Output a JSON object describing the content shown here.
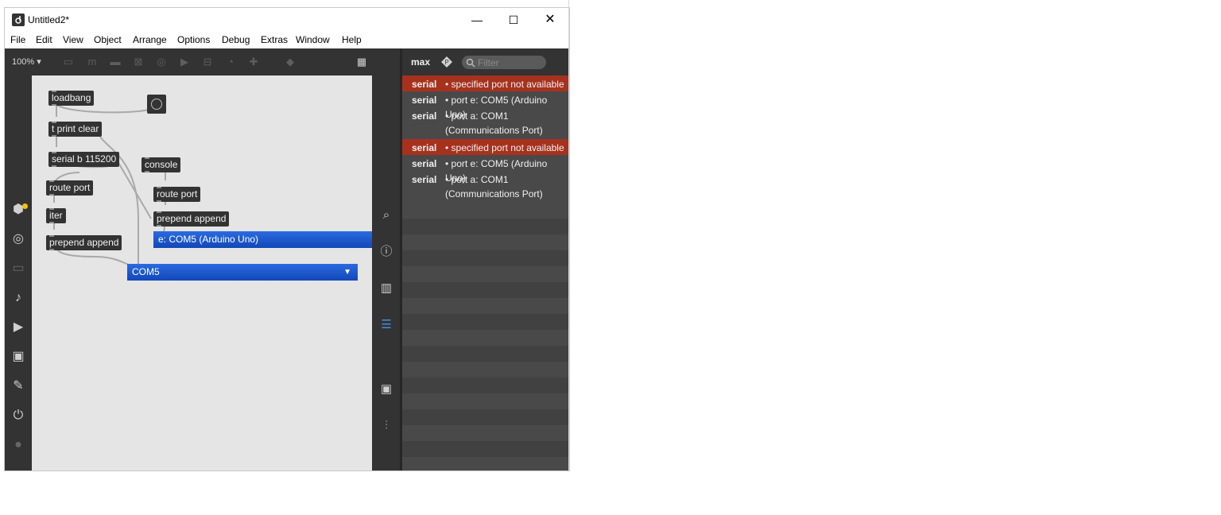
{
  "window": {
    "title": "Untitled2*"
  },
  "menu": [
    "File",
    "Edit",
    "View",
    "Object",
    "Arrange",
    "Options",
    "Debug",
    "Extras",
    "Window",
    "Help"
  ],
  "toolbar": {
    "zoom": "100%"
  },
  "patch": {
    "objects": {
      "loadbang": "loadbang",
      "trigger": "t print clear",
      "serial": "serial b 115200",
      "console": "console",
      "route_left": "route port",
      "route_right": "route port",
      "iter": "iter",
      "prepend_left": "prepend append",
      "prepend_right": "prepend append"
    },
    "menus": {
      "port_menu": "e: COM5 (Arduino Uno)",
      "com_menu": "COM5"
    }
  },
  "console": {
    "title": "max",
    "filter_placeholder": "Filter",
    "messages": [
      {
        "source": "serial",
        "text": "• specified port not available",
        "error": true
      },
      {
        "source": "serial",
        "text": "• port e: COM5 (Arduino Uno)",
        "error": false
      },
      {
        "source": "serial",
        "text": "• port a: COM1 (Communications Port)",
        "error": false
      },
      {
        "source": "serial",
        "text": "• specified port not available",
        "error": true
      },
      {
        "source": "serial",
        "text": "• port e: COM5 (Arduino Uno)",
        "error": false
      },
      {
        "source": "serial",
        "text": "• port a: COM1 (Communications Port)",
        "error": false
      }
    ]
  },
  "colors": {
    "error_bg": "#a6321e",
    "menu_blue": "#1a56cc",
    "dark": "#333333"
  }
}
